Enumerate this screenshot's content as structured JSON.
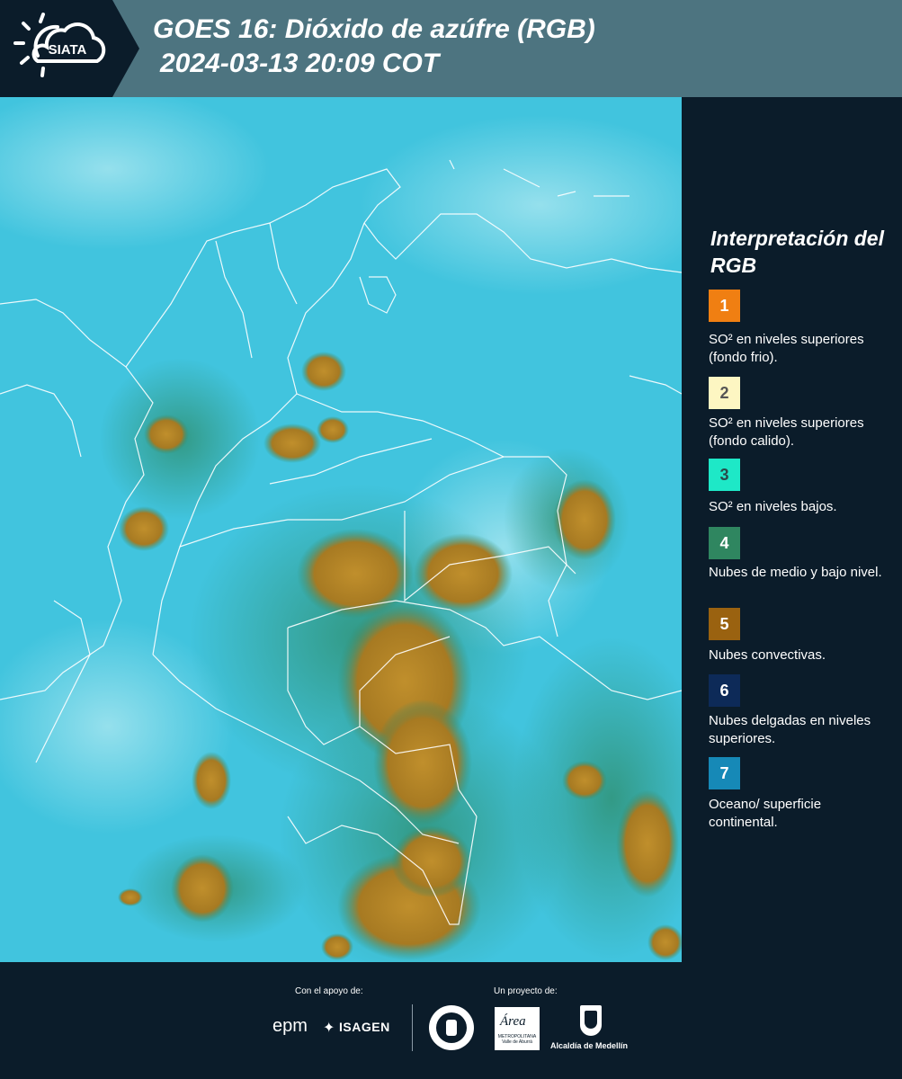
{
  "header": {
    "logo_text": "SIATA",
    "title_line1": "GOES 16: Dióxido de azúfre (RGB)",
    "title_line2": "2024-03-13 20:09 COT"
  },
  "legend": {
    "title": "Interpretación del RGB",
    "items": [
      {
        "number": "1",
        "color": "#f07f12",
        "text_color": "#ffffff",
        "label": "SO² en niveles superiores (fondo frio)."
      },
      {
        "number": "2",
        "color": "#fdf6c2",
        "text_color": "#555555",
        "label": "SO² en niveles superiores (fondo calido)."
      },
      {
        "number": "3",
        "color": "#1ee8c7",
        "text_color": "#2a4a4a",
        "label": "SO² en niveles bajos."
      },
      {
        "number": "4",
        "color": "#2f8660",
        "text_color": "#ffffff",
        "label": "Nubes de medio y bajo nivel."
      },
      {
        "number": "5",
        "color": "#9a6210",
        "text_color": "#ffffff",
        "label": "Nubes convectivas."
      },
      {
        "number": "6",
        "color": "#0d2a58",
        "text_color": "#ffffff",
        "label": "Nubes delgadas en niveles superiores."
      },
      {
        "number": "7",
        "color": "#1689b7",
        "text_color": "#ffffff",
        "label": "Oceano/ superficie continental."
      }
    ]
  },
  "footer": {
    "support_label": "Con el apoyo de:",
    "project_label": "Un proyecto de:",
    "sponsor_epm": "epm",
    "sponsor_isagen": "ISAGEN",
    "area_logo_text": "Área",
    "area_subtext": "METROPOLITANA Valle de Aburrá",
    "alcaldia_text": "Alcaldía de Medellín"
  },
  "map": {
    "description_icon": "satellite-rgb-image",
    "ocean_color": "#3fc6e0",
    "cloud_color": "#b98a2a",
    "border_color": "#ffffff"
  }
}
